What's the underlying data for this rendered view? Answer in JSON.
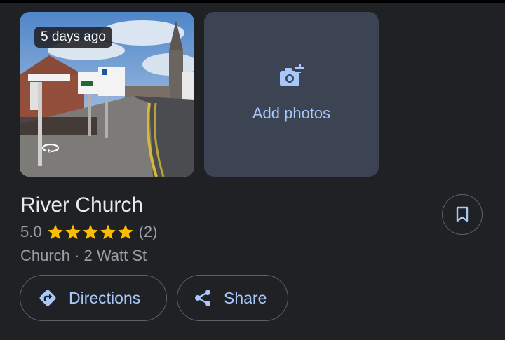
{
  "photo": {
    "age_label": "5 days ago",
    "rotate_icon": "360-rotate-icon"
  },
  "add_photos": {
    "label": "Add photos",
    "icon": "add-photo-camera-icon"
  },
  "place": {
    "name": "River Church",
    "rating": "5.0",
    "stars": 5,
    "review_count": "(2)",
    "category_address": "Church · 2 Watt St"
  },
  "actions": {
    "directions_label": "Directions",
    "share_label": "Share",
    "save_icon": "bookmark-icon"
  },
  "colors": {
    "background": "#202124",
    "accent": "#a8c7fa",
    "star": "#fbbc04",
    "secondary_text": "#9aa0a6"
  }
}
